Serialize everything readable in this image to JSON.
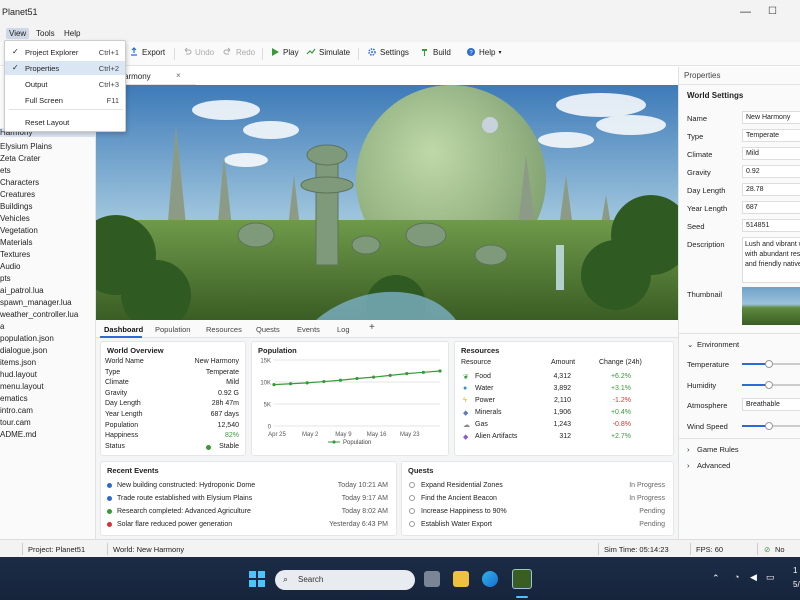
{
  "window": {
    "title": "Planet51"
  },
  "menubar": {
    "items": [
      "View",
      "Tools",
      "Help"
    ]
  },
  "toolbar": {
    "export": "Export",
    "undo": "Undo",
    "redo": "Redo",
    "play": "Play",
    "simulate": "Simulate",
    "settings": "Settings",
    "build": "Build",
    "help": "Help"
  },
  "view_menu": {
    "items": [
      {
        "label": "Project Explorer",
        "shortcut": "Ctrl+1",
        "checked": true
      },
      {
        "label": "Properties",
        "shortcut": "Ctrl+2",
        "checked": true
      },
      {
        "label": "Output",
        "shortcut": "Ctrl+3",
        "checked": false
      },
      {
        "label": "Full Screen",
        "shortcut": "F11",
        "checked": false
      },
      {
        "label": "Reset Layout",
        "shortcut": "",
        "checked": false
      }
    ]
  },
  "sidebar": {
    "items": [
      "Harmony",
      "Elysium Plains",
      "Zeta Crater",
      "ets",
      "Characters",
      "Creatures",
      "Buildings",
      "Vehicles",
      "Vegetation",
      "Materials",
      "Textures",
      "Audio",
      "pts",
      "ai_patrol.lua",
      "spawn_manager.lua",
      "weather_controller.lua",
      "a",
      "population.json",
      "dialogue.json",
      "items.json",
      "hud.layout",
      "menu.layout",
      "ematics",
      "intro.cam",
      "tour.cam",
      "ADME.md"
    ]
  },
  "doc_tab": {
    "label": "armony",
    "close": "×"
  },
  "bottom_tabs": [
    "Dashboard",
    "Population",
    "Resources",
    "Quests",
    "Events",
    "Log",
    "+"
  ],
  "world_overview": {
    "title": "World Overview",
    "rows": [
      {
        "k": "World Name",
        "v": "New Harmony"
      },
      {
        "k": "Type",
        "v": "Temperate"
      },
      {
        "k": "Climate",
        "v": "Mild"
      },
      {
        "k": "Gravity",
        "v": "0.92 G"
      },
      {
        "k": "Day Length",
        "v": "28h 47m"
      },
      {
        "k": "Year Length",
        "v": "687 days"
      },
      {
        "k": "Population",
        "v": "12,540"
      },
      {
        "k": "Happiness",
        "v": "82%"
      },
      {
        "k": "Status",
        "v": "Stable"
      }
    ]
  },
  "chart_data": {
    "type": "line",
    "title": "Population",
    "x": [
      "Apr 25",
      "",
      "May 2",
      "",
      "May 9",
      "",
      "May 16",
      "",
      "May 23",
      "",
      ""
    ],
    "xticks": [
      "Apr 25",
      "May 2",
      "May 9",
      "May 16",
      "May 23"
    ],
    "series": [
      {
        "name": "Population",
        "values": [
          9400,
          9600,
          9800,
          10100,
          10400,
          10800,
          11100,
          11500,
          11900,
          12200,
          12500
        ]
      }
    ],
    "ylim": [
      0,
      15000
    ],
    "yticks": [
      "0",
      "5K",
      "10K",
      "15K"
    ]
  },
  "resources": {
    "title": "Resources",
    "headers": [
      "Resource",
      "Amount",
      "Change (24h)"
    ],
    "rows": [
      {
        "name": "Food",
        "amount": "4,312",
        "change": "+6.2%",
        "icon": "leaf-icon",
        "color": "#3a9a3a"
      },
      {
        "name": "Water",
        "amount": "3,892",
        "change": "+3.1%",
        "icon": "water-drop-icon",
        "color": "#2b8fd4"
      },
      {
        "name": "Power",
        "amount": "2,110",
        "change": "-1.2%",
        "icon": "lightning-icon",
        "color": "#f0a800"
      },
      {
        "name": "Minerals",
        "amount": "1,906",
        "change": "+0.4%",
        "icon": "crystal-icon",
        "color": "#5a7bbf"
      },
      {
        "name": "Gas",
        "amount": "1,243",
        "change": "-0.8%",
        "icon": "cloud-icon",
        "color": "#888888"
      },
      {
        "name": "Alien Artifacts",
        "amount": "312",
        "change": "+2.7%",
        "icon": "gem-icon",
        "color": "#8a5ad4"
      }
    ]
  },
  "recent_events": {
    "title": "Recent Events",
    "rows": [
      {
        "text": "New building constructed: Hydroponic Dome",
        "time": "Today 10:21 AM",
        "color": "#2b6cd4"
      },
      {
        "text": "Trade route established with Elysium Plains",
        "time": "Today 9:17 AM",
        "color": "#2b6cd4"
      },
      {
        "text": "Research completed: Advanced Agriculture",
        "time": "Today 8:02 AM",
        "color": "#3a9a3a"
      },
      {
        "text": "Solar flare reduced power generation",
        "time": "Yesterday 6:43 PM",
        "color": "#d33333"
      }
    ]
  },
  "quests": {
    "title": "Quests",
    "rows": [
      {
        "text": "Expand Residential Zones",
        "status": "In Progress"
      },
      {
        "text": "Find the Ancient Beacon",
        "status": "In Progress"
      },
      {
        "text": "Increase Happiness to 90%",
        "status": "Pending"
      },
      {
        "text": "Establish Water Export",
        "status": "Pending"
      }
    ]
  },
  "properties": {
    "header": "Properties",
    "section": "World Settings",
    "fields": [
      {
        "label": "Name",
        "value": "New Harmony"
      },
      {
        "label": "Type",
        "value": "Temperate"
      },
      {
        "label": "Climate",
        "value": "Mild"
      },
      {
        "label": "Gravity",
        "value": "0.92"
      },
      {
        "label": "Day Length",
        "value": "28.78"
      },
      {
        "label": "Year Length",
        "value": "687"
      },
      {
        "label": "Seed",
        "value": "514851"
      }
    ],
    "description_label": "Description",
    "description": [
      "Lush and vibrant w",
      "with abundant res",
      "and friendly native"
    ],
    "thumbnail_label": "Thumbnail",
    "environment": "Environment",
    "temperature": "Temperature",
    "humidity": "Humidity",
    "atmosphere": "Atmosphere",
    "atmosphere_value": "Breathable",
    "wind_speed": "Wind Speed",
    "game_rules": "Game Rules",
    "advanced": "Advanced",
    "temperature_level": 0.45,
    "humidity_level": 0.45,
    "wind_level": 0.45
  },
  "statusbar": {
    "project": "Project: Planet51",
    "world": "World: New Harmony",
    "sim_time": "Sim Time: 05:14:23",
    "fps": "FPS: 60",
    "errors": "No errors"
  },
  "taskbar": {
    "search": "Search",
    "time": "1",
    "date": "5/"
  }
}
